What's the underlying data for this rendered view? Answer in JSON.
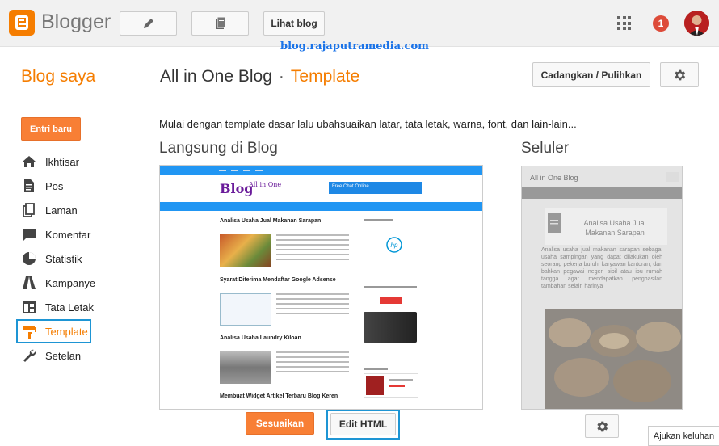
{
  "header": {
    "brand": "Blogger",
    "view_blog_label": "Lihat blog",
    "notification_count": "1",
    "watermark": "blog.rajaputramedia.com"
  },
  "page": {
    "blog_list_title": "Blog saya",
    "blog_name": "All in One Blog",
    "separator": "·",
    "section": "Template",
    "backup_label": "Cadangkan / Pulihkan",
    "new_post_label": "Entri baru",
    "description": "Mulai dengan template dasar lalu ubahsuaikan latar, tata letak, warna, font, dan lain-lain..."
  },
  "sidebar": {
    "items": [
      {
        "label": "Ikhtisar",
        "icon": "home-icon"
      },
      {
        "label": "Pos",
        "icon": "posts-icon"
      },
      {
        "label": "Laman",
        "icon": "pages-icon"
      },
      {
        "label": "Komentar",
        "icon": "comments-icon"
      },
      {
        "label": "Statistik",
        "icon": "stats-icon"
      },
      {
        "label": "Kampanye",
        "icon": "campaigns-icon"
      },
      {
        "label": "Tata Letak",
        "icon": "layout-icon"
      },
      {
        "label": "Template",
        "icon": "template-icon",
        "active": true
      },
      {
        "label": "Setelan",
        "icon": "settings-icon"
      }
    ]
  },
  "live": {
    "heading": "Langsung di Blog",
    "customize_label": "Sesuaikan",
    "edit_html_label": "Edit HTML",
    "preview": {
      "logo": "Blog",
      "logo_sub": "All in One",
      "ad_text": "Free Chat Online",
      "posts": [
        {
          "title": "Analisa Usaha Jual Makanan Sarapan"
        },
        {
          "title": "Syarat Diterima Mendaftar Google Adsense"
        },
        {
          "title": "Analisa Usaha Laundry Kiloan"
        },
        {
          "title": "Membuat Widget Artikel Terbaru Blog Keren"
        }
      ]
    }
  },
  "mobile": {
    "heading": "Seluler",
    "blog_title": "All in One Blog",
    "post_title": "Analisa Usaha Jual Makanan Sarapan",
    "post_excerpt": "Analisa usaha jual makanan sarapan sebagai usaha sampingan yang dapat dilakukan oleh seorang pekerja buruh, karyawan kantoran, dan bahkan pegawai negeri sipil atau ibu rumah tangga agar mendapatkan penghasilan tambahan selain harinya"
  },
  "feedback_label": "Ajukan keluhan",
  "colors": {
    "accent": "#f57d00",
    "highlight": "#1e95d4",
    "button_orange": "#f87f35"
  }
}
